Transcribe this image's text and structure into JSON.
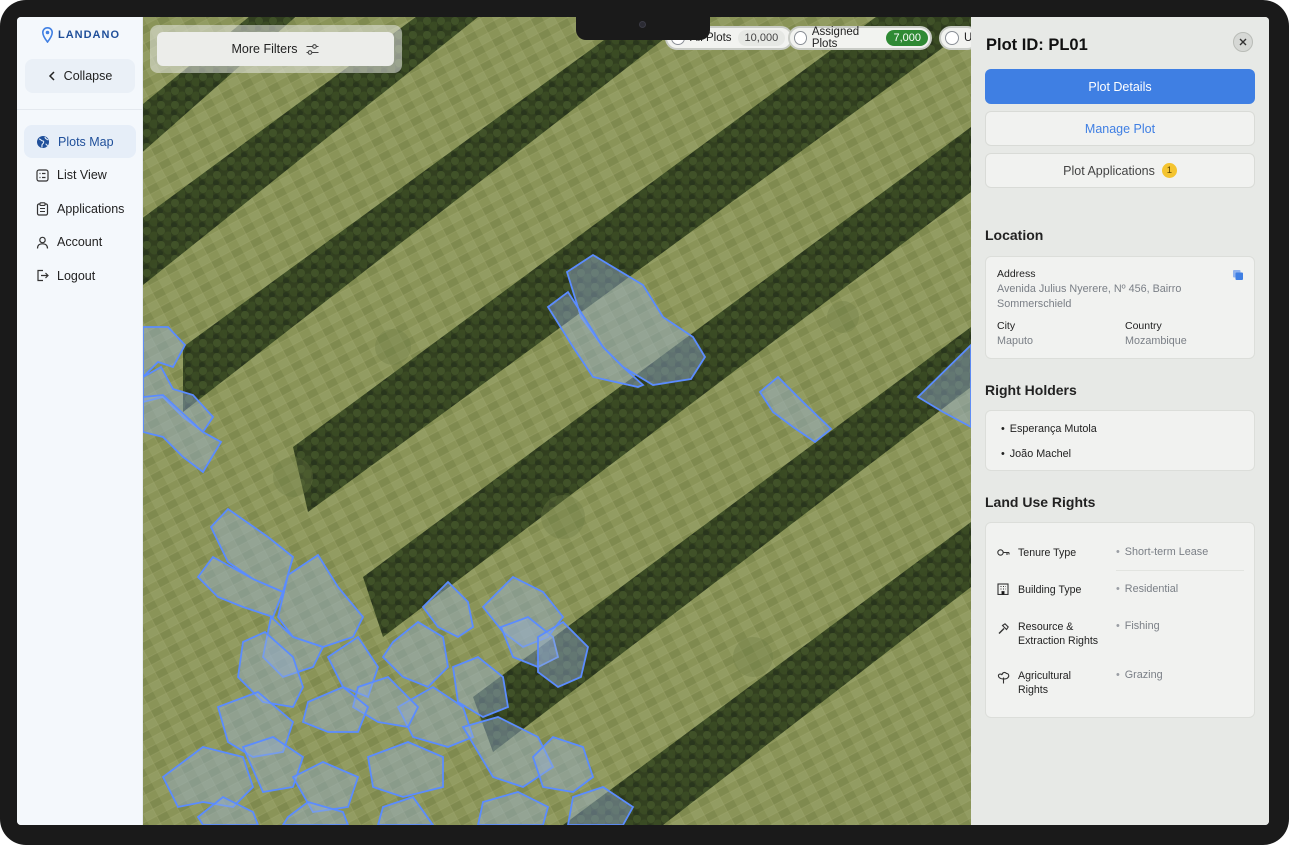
{
  "brand": {
    "name": "LANDANO",
    "accent": "#3f7fe3",
    "plot_outline": "#5b8cff"
  },
  "sidebar": {
    "collapse_label": "Collapse",
    "items": [
      {
        "label": "Plots Map",
        "icon": "globe-icon",
        "active": true
      },
      {
        "label": "List View",
        "icon": "list-icon",
        "active": false
      },
      {
        "label": "Applications",
        "icon": "clipboard-icon",
        "active": false
      },
      {
        "label": "Account",
        "icon": "user-icon",
        "active": false
      },
      {
        "label": "Logout",
        "icon": "logout-icon",
        "active": false
      }
    ]
  },
  "map": {
    "more_filters_label": "More Filters",
    "chips": [
      {
        "label": "All Plots",
        "count": "10,000"
      },
      {
        "label": "Assigned Plots",
        "count": "7,000"
      },
      {
        "label": "U"
      }
    ]
  },
  "panel": {
    "title": "Plot ID: PL01",
    "buttons": {
      "details": "Plot Details",
      "manage": "Manage Plot",
      "applications": "Plot Applications",
      "applications_badge": "1"
    },
    "location": {
      "title": "Location",
      "address_label": "Address",
      "address_line1": "Avenida Julius Nyerere, Nº 456, Bairro",
      "address_line2": "Sommerschield",
      "city_label": "City",
      "city": "Maputo",
      "country_label": "Country",
      "country": "Mozambique"
    },
    "right_holders": {
      "title": "Right Holders",
      "items": [
        "Esperança Mutola",
        "João Machel"
      ]
    },
    "land_use": {
      "title": "Land Use Rights",
      "rows": [
        {
          "label": "Tenure Type",
          "value": "Short-term Lease",
          "icon": "key-icon"
        },
        {
          "label": "Building Type",
          "value": "Residential",
          "icon": "building-icon"
        },
        {
          "label_line1": "Resource &",
          "label_line2": "Extraction Rights",
          "value": "Fishing",
          "icon": "hammer-icon"
        },
        {
          "label_line1": "Agricultural",
          "label_line2": "Rights",
          "value": "Grazing",
          "icon": "plant-icon"
        }
      ]
    }
  }
}
